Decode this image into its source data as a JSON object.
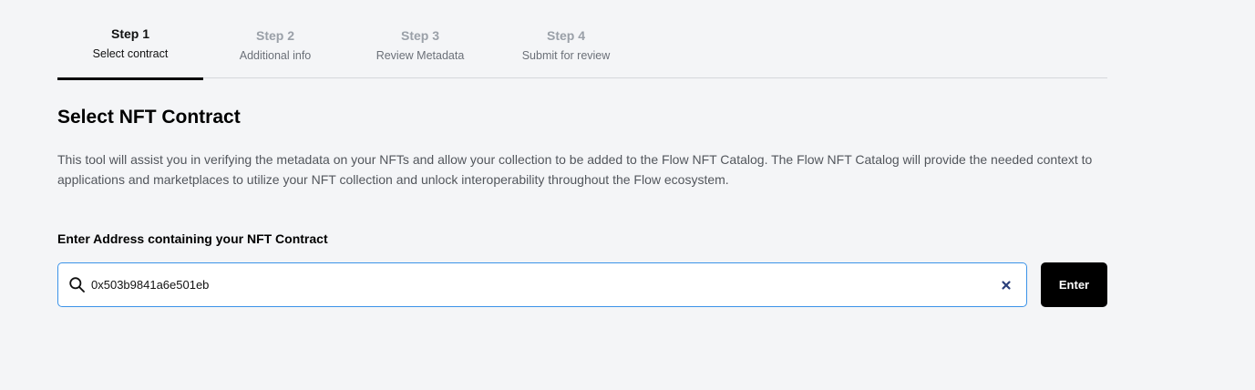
{
  "steps": [
    {
      "num": "Step 1",
      "label": "Select contract"
    },
    {
      "num": "Step 2",
      "label": "Additional info"
    },
    {
      "num": "Step 3",
      "label": "Review Metadata"
    },
    {
      "num": "Step 4",
      "label": "Submit for review"
    }
  ],
  "active_step": "Step 1",
  "main": {
    "title": "Select NFT Contract",
    "description": "This tool will assist you in verifying the metadata on your NFTs and allow your collection to be added to the Flow NFT Catalog. The Flow NFT Catalog will provide the needed context to applications and marketplaces to utilize your NFT collection and unlock interoperability throughout the Flow ecosystem.",
    "address_label": "Enter Address containing your NFT Contract",
    "address_value": "0x503b9841a6e501eb",
    "enter_label": "Enter"
  },
  "icons": {
    "search": "search-icon",
    "clear": "close-icon"
  },
  "colors": {
    "accent_border": "#3b93e8",
    "button_bg": "#000000",
    "clear_icon": "#2a3f7a"
  }
}
